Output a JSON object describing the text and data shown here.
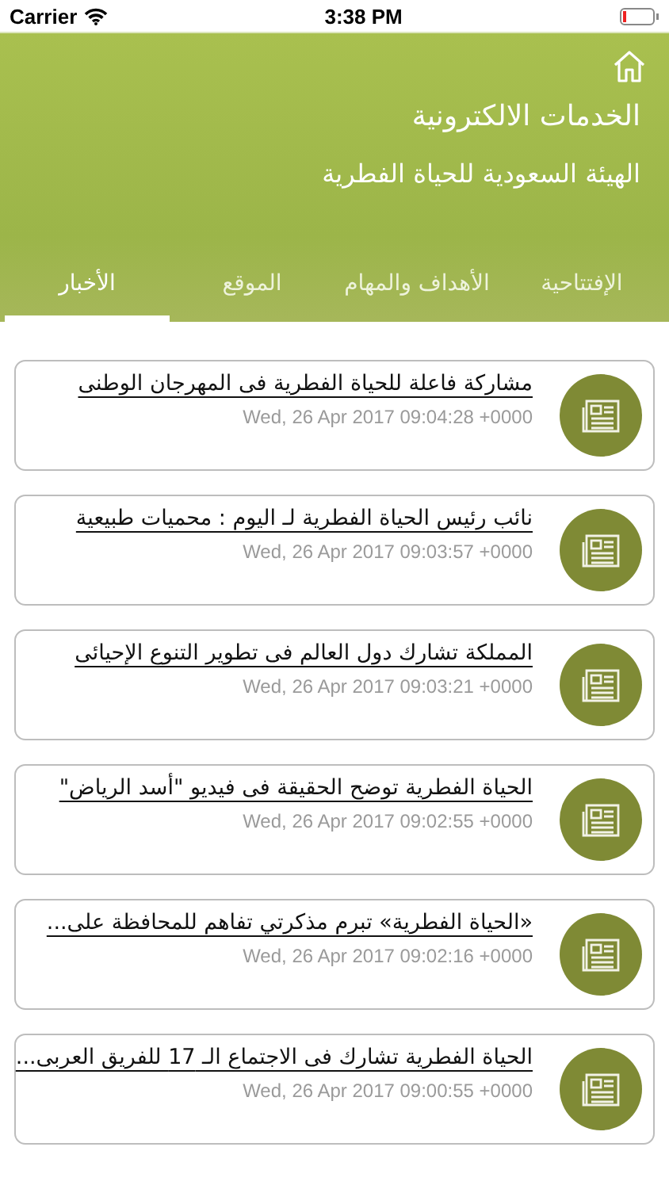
{
  "status_bar": {
    "carrier": "Carrier",
    "time": "3:38 PM"
  },
  "header": {
    "title": "الخدمات الالكترونية",
    "subtitle": "الهيئة السعودية للحياة الفطرية"
  },
  "tabs": [
    {
      "label": "الإفتتاحية",
      "selected": false
    },
    {
      "label": "الأهداف والمهام",
      "selected": false
    },
    {
      "label": "الموقع",
      "selected": false
    },
    {
      "label": "الأخبار",
      "selected": true
    }
  ],
  "news": [
    {
      "title": "مشاركة فاعلة للحياة الفطرية فى المهرجان الوطنى",
      "date": "Wed, 26 Apr 2017 09:04:28 +0000"
    },
    {
      "title": "نائب رئيس الحياة الفطرية لـ اليوم : محميات طبيعية",
      "date": "Wed, 26 Apr 2017 09:03:57 +0000"
    },
    {
      "title": "المملكة تشارك دول العالم فى تطوير التنوع الإحيائى",
      "date": "Wed, 26 Apr 2017 09:03:21 +0000"
    },
    {
      "title": "الحياة الفطرية توضح الحقيقة فى فيديو \"أسد الرياض\"",
      "date": "Wed, 26 Apr 2017 09:02:55 +0000"
    },
    {
      "title": "«الحياة الفطرية» تبرم مذكرتي تفاهم للمحافظة على...",
      "date": "Wed, 26 Apr 2017 09:02:16 +0000"
    },
    {
      "title": "الحياة الفطرية تشارك فى الاجتماع الـ 17 للفريق العربى...",
      "date": "Wed, 26 Apr 2017 09:00:55 +0000"
    }
  ]
}
